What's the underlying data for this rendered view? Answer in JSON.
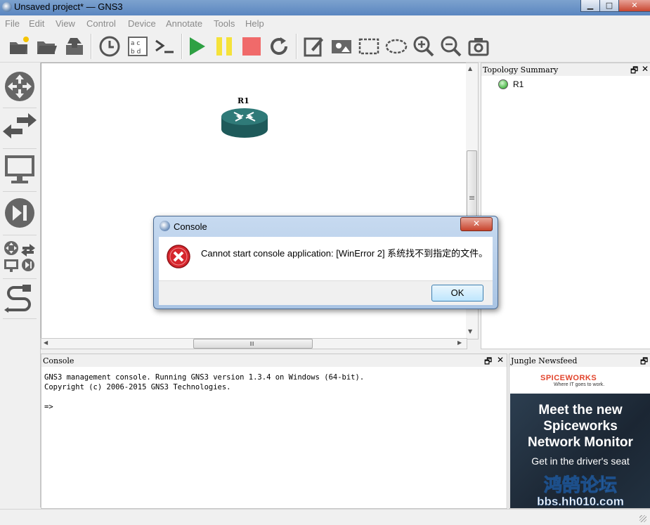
{
  "window": {
    "title": "Unsaved project* — GNS3",
    "minimize": "▁",
    "maximize": "□",
    "close": "✕"
  },
  "menu": [
    "File",
    "Edit",
    "View",
    "Control",
    "Device",
    "Annotate",
    "Tools",
    "Help"
  ],
  "toolbar": {
    "icons": [
      "new-project-icon",
      "open-project-icon",
      "save-project-icon",
      "snapshot-clock-icon",
      "show-interface-labels-icon",
      "console-all-icon",
      "start-all-icon",
      "suspend-all-icon",
      "stop-all-icon",
      "reload-all-icon",
      "add-note-icon",
      "insert-picture-icon",
      "draw-rectangle-icon",
      "draw-ellipse-icon",
      "zoom-in-icon",
      "zoom-out-icon",
      "screenshot-icon"
    ]
  },
  "devices_dock": {
    "icons": [
      "routers-icon",
      "switches-icon",
      "end-devices-icon",
      "security-devices-icon",
      "all-devices-icon",
      "add-link-icon"
    ]
  },
  "canvas": {
    "node": {
      "label": "R1",
      "icon": "router-icon"
    }
  },
  "topology_summary": {
    "title": "Topology Summary",
    "items": [
      {
        "name": "R1",
        "status_color": "#5fc25c"
      }
    ]
  },
  "console": {
    "title": "Console",
    "lines": "GNS3 management console. Running GNS3 version 1.3.4 on Windows (64-bit).\nCopyright (c) 2006-2015 GNS3 Technologies.\n\n=>"
  },
  "newsfeed": {
    "title": "Jungle Newsfeed",
    "logo": "SPICEWORKS",
    "tagline": "Where IT goes to work.",
    "headline_1": "Meet the new",
    "headline_2": "Spiceworks",
    "headline_3": "Network Monitor",
    "subline": "Get in the driver's seat",
    "watermark_cn": "鸿鹄论坛",
    "watermark_url": "bbs.hh010.com"
  },
  "dock_controls": {
    "float": "🗗",
    "close": "✕"
  },
  "dialog": {
    "title": "Console",
    "message": "Cannot start console application: [WinError 2] 系统找不到指定的文件。",
    "ok": "OK",
    "close": "✕"
  },
  "colors": {
    "accent": "#2ea043",
    "pause": "#f5e23a",
    "stop": "#f06a6a",
    "error": "#d6252c"
  }
}
